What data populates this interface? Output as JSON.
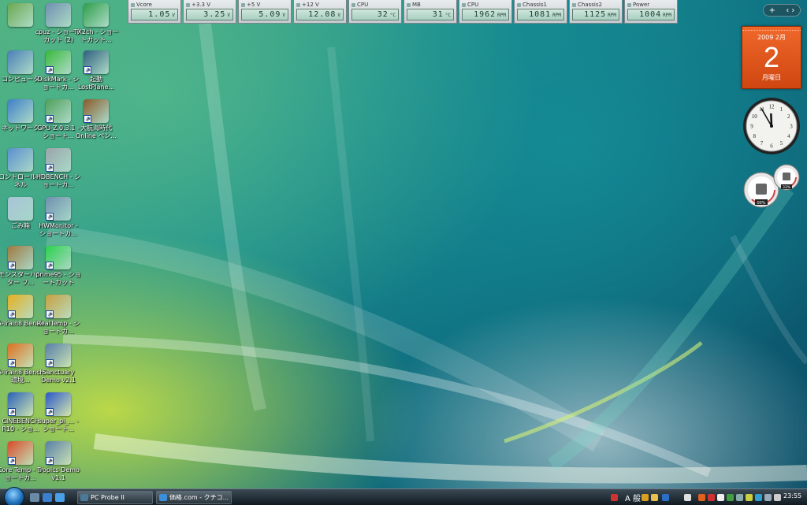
{
  "sensors": [
    {
      "label": "Vcore",
      "value": "1.05",
      "unit": "V"
    },
    {
      "label": "+3.3 V",
      "value": "3.25",
      "unit": "V"
    },
    {
      "label": "+5 V",
      "value": "5.09",
      "unit": "V"
    },
    {
      "label": "+12 V",
      "value": "12.08",
      "unit": "V"
    },
    {
      "label": "CPU",
      "value": "32",
      "unit": "°C"
    },
    {
      "label": "MB",
      "value": "31",
      "unit": "°C"
    },
    {
      "label": "CPU",
      "value": "1962",
      "unit": "RPM"
    },
    {
      "label": "Chassis1",
      "value": "1081",
      "unit": "RPM"
    },
    {
      "label": "Chassis2",
      "value": "1125",
      "unit": "RPM"
    },
    {
      "label": "Power",
      "value": "1004",
      "unit": "RPM"
    }
  ],
  "sidebar_toggle": {
    "add": "+",
    "arrows": "‹ ›"
  },
  "desktop_icons": [
    {
      "name": "",
      "icon": "user-folder-icon",
      "color": "#6aa84f"
    },
    {
      "name": "cpuz - ショートカット (2)",
      "icon": "cpuz-icon",
      "color": "#6f8fb0"
    },
    {
      "name": "TX2ch - ショートカット...",
      "icon": "tx2ch-icon",
      "color": "#2e9f4a"
    },
    {
      "name": "コンピュータ",
      "icon": "computer-icon",
      "color": "#4a7fb8"
    },
    {
      "name": "DiskMark - ショートカ...",
      "icon": "diskmark-icon",
      "color": "#38b83a"
    },
    {
      "name": "起動 LostPlane...",
      "icon": "lost-planet-icon",
      "color": "#2f5f7f"
    },
    {
      "name": "ネットワーク",
      "icon": "network-icon",
      "color": "#3f7fc8"
    },
    {
      "name": "GPU-Z.0.3.1 - ショート...",
      "icon": "gpuz-icon",
      "color": "#4f9f5a"
    },
    {
      "name": "大航海時代 Online ペン...",
      "icon": "ship-icon",
      "color": "#8a5a2a"
    },
    {
      "name": "コントロールパネル",
      "icon": "control-panel-icon",
      "color": "#5a8fd0"
    },
    {
      "name": "HDBENCH - ショートカ...",
      "icon": "hdbench-icon",
      "color": "#9aa4aa"
    },
    {
      "name": "ごみ箱",
      "icon": "recycle-bin-icon",
      "color": "#a8c4d8"
    },
    {
      "name": "HWMonitor - ショートカ...",
      "icon": "hwmonitor-icon",
      "color": "#6f8fb0"
    },
    {
      "name": "モンスターハンター フ...",
      "icon": "monster-hunter-icon",
      "color": "#a07a40"
    },
    {
      "name": "prime95 - ショートカット",
      "icon": "prime95-icon",
      "color": "#29d24a"
    },
    {
      "name": "A-Train8 Bench",
      "icon": "atrain-icon",
      "color": "#e8b020"
    },
    {
      "name": "RealTemp - ショートカ...",
      "icon": "realtemp-icon",
      "color": "#c8a040"
    },
    {
      "name": "A-Train8 Bench環境...",
      "icon": "atrain-env-icon",
      "color": "#e07020"
    },
    {
      "name": "Sanctuary Demo v2.1",
      "icon": "sanctuary-icon",
      "color": "#5a7fa8"
    },
    {
      "name": "CINEBENCH R10 - ショ...",
      "icon": "cinebench-icon",
      "color": "#2a60b8"
    },
    {
      "name": "super_pi_... - ショート...",
      "icon": "super-pi-icon",
      "color": "#2a56c8"
    },
    {
      "name": "Core Temp - ショートカ...",
      "icon": "core-temp-icon",
      "color": "#d84a2a"
    },
    {
      "name": "Tropics Demo v1.1",
      "icon": "tropics-icon",
      "color": "#5a7fa8"
    }
  ],
  "calendar": {
    "month": "2009 2月",
    "day": "2",
    "weekday": "月曜日"
  },
  "clock": {
    "time": "23:55"
  },
  "cpu_meter": {
    "cpu_percent": 0,
    "ram_percent": 33,
    "cpu_label": "00%",
    "ram_label": "33%"
  },
  "taskbar": {
    "tasks": [
      {
        "label": "PC Probe II",
        "icon": "pc-probe-icon",
        "color": "#4a7a9a"
      },
      {
        "label": "価格.com - クチコ...",
        "icon": "ie-icon",
        "color": "#3a8fd8"
      }
    ],
    "ime": "A 般",
    "tray_clock": "23:55"
  }
}
